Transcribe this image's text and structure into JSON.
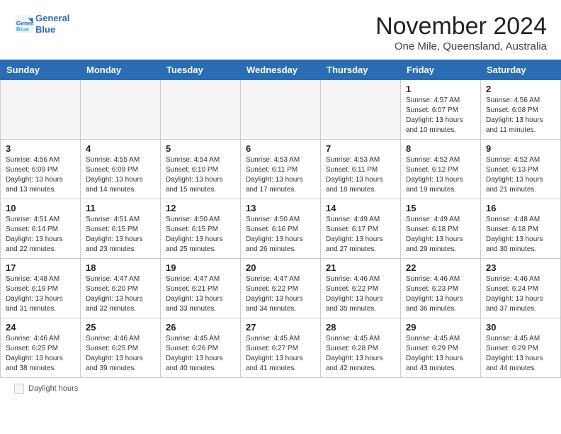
{
  "header": {
    "logo_line1": "General",
    "logo_line2": "Blue",
    "month": "November 2024",
    "location": "One Mile, Queensland, Australia"
  },
  "days_of_week": [
    "Sunday",
    "Monday",
    "Tuesday",
    "Wednesday",
    "Thursday",
    "Friday",
    "Saturday"
  ],
  "weeks": [
    [
      {
        "day": "",
        "info": ""
      },
      {
        "day": "",
        "info": ""
      },
      {
        "day": "",
        "info": ""
      },
      {
        "day": "",
        "info": ""
      },
      {
        "day": "",
        "info": ""
      },
      {
        "day": "1",
        "info": "Sunrise: 4:57 AM\nSunset: 6:07 PM\nDaylight: 13 hours and 10 minutes."
      },
      {
        "day": "2",
        "info": "Sunrise: 4:56 AM\nSunset: 6:08 PM\nDaylight: 13 hours and 11 minutes."
      }
    ],
    [
      {
        "day": "3",
        "info": "Sunrise: 4:56 AM\nSunset: 6:09 PM\nDaylight: 13 hours and 13 minutes."
      },
      {
        "day": "4",
        "info": "Sunrise: 4:55 AM\nSunset: 6:09 PM\nDaylight: 13 hours and 14 minutes."
      },
      {
        "day": "5",
        "info": "Sunrise: 4:54 AM\nSunset: 6:10 PM\nDaylight: 13 hours and 15 minutes."
      },
      {
        "day": "6",
        "info": "Sunrise: 4:53 AM\nSunset: 6:11 PM\nDaylight: 13 hours and 17 minutes."
      },
      {
        "day": "7",
        "info": "Sunrise: 4:53 AM\nSunset: 6:11 PM\nDaylight: 13 hours and 18 minutes."
      },
      {
        "day": "8",
        "info": "Sunrise: 4:52 AM\nSunset: 6:12 PM\nDaylight: 13 hours and 19 minutes."
      },
      {
        "day": "9",
        "info": "Sunrise: 4:52 AM\nSunset: 6:13 PM\nDaylight: 13 hours and 21 minutes."
      }
    ],
    [
      {
        "day": "10",
        "info": "Sunrise: 4:51 AM\nSunset: 6:14 PM\nDaylight: 13 hours and 22 minutes."
      },
      {
        "day": "11",
        "info": "Sunrise: 4:51 AM\nSunset: 6:15 PM\nDaylight: 13 hours and 23 minutes."
      },
      {
        "day": "12",
        "info": "Sunrise: 4:50 AM\nSunset: 6:15 PM\nDaylight: 13 hours and 25 minutes."
      },
      {
        "day": "13",
        "info": "Sunrise: 4:50 AM\nSunset: 6:16 PM\nDaylight: 13 hours and 26 minutes."
      },
      {
        "day": "14",
        "info": "Sunrise: 4:49 AM\nSunset: 6:17 PM\nDaylight: 13 hours and 27 minutes."
      },
      {
        "day": "15",
        "info": "Sunrise: 4:49 AM\nSunset: 6:18 PM\nDaylight: 13 hours and 29 minutes."
      },
      {
        "day": "16",
        "info": "Sunrise: 4:48 AM\nSunset: 6:18 PM\nDaylight: 13 hours and 30 minutes."
      }
    ],
    [
      {
        "day": "17",
        "info": "Sunrise: 4:48 AM\nSunset: 6:19 PM\nDaylight: 13 hours and 31 minutes."
      },
      {
        "day": "18",
        "info": "Sunrise: 4:47 AM\nSunset: 6:20 PM\nDaylight: 13 hours and 32 minutes."
      },
      {
        "day": "19",
        "info": "Sunrise: 4:47 AM\nSunset: 6:21 PM\nDaylight: 13 hours and 33 minutes."
      },
      {
        "day": "20",
        "info": "Sunrise: 4:47 AM\nSunset: 6:22 PM\nDaylight: 13 hours and 34 minutes."
      },
      {
        "day": "21",
        "info": "Sunrise: 4:46 AM\nSunset: 6:22 PM\nDaylight: 13 hours and 35 minutes."
      },
      {
        "day": "22",
        "info": "Sunrise: 4:46 AM\nSunset: 6:23 PM\nDaylight: 13 hours and 36 minutes."
      },
      {
        "day": "23",
        "info": "Sunrise: 4:46 AM\nSunset: 6:24 PM\nDaylight: 13 hours and 37 minutes."
      }
    ],
    [
      {
        "day": "24",
        "info": "Sunrise: 4:46 AM\nSunset: 6:25 PM\nDaylight: 13 hours and 38 minutes."
      },
      {
        "day": "25",
        "info": "Sunrise: 4:46 AM\nSunset: 6:25 PM\nDaylight: 13 hours and 39 minutes."
      },
      {
        "day": "26",
        "info": "Sunrise: 4:45 AM\nSunset: 6:26 PM\nDaylight: 13 hours and 40 minutes."
      },
      {
        "day": "27",
        "info": "Sunrise: 4:45 AM\nSunset: 6:27 PM\nDaylight: 13 hours and 41 minutes."
      },
      {
        "day": "28",
        "info": "Sunrise: 4:45 AM\nSunset: 6:28 PM\nDaylight: 13 hours and 42 minutes."
      },
      {
        "day": "29",
        "info": "Sunrise: 4:45 AM\nSunset: 6:29 PM\nDaylight: 13 hours and 43 minutes."
      },
      {
        "day": "30",
        "info": "Sunrise: 4:45 AM\nSunset: 6:29 PM\nDaylight: 13 hours and 44 minutes."
      }
    ]
  ],
  "legend": {
    "label": "Daylight hours"
  }
}
